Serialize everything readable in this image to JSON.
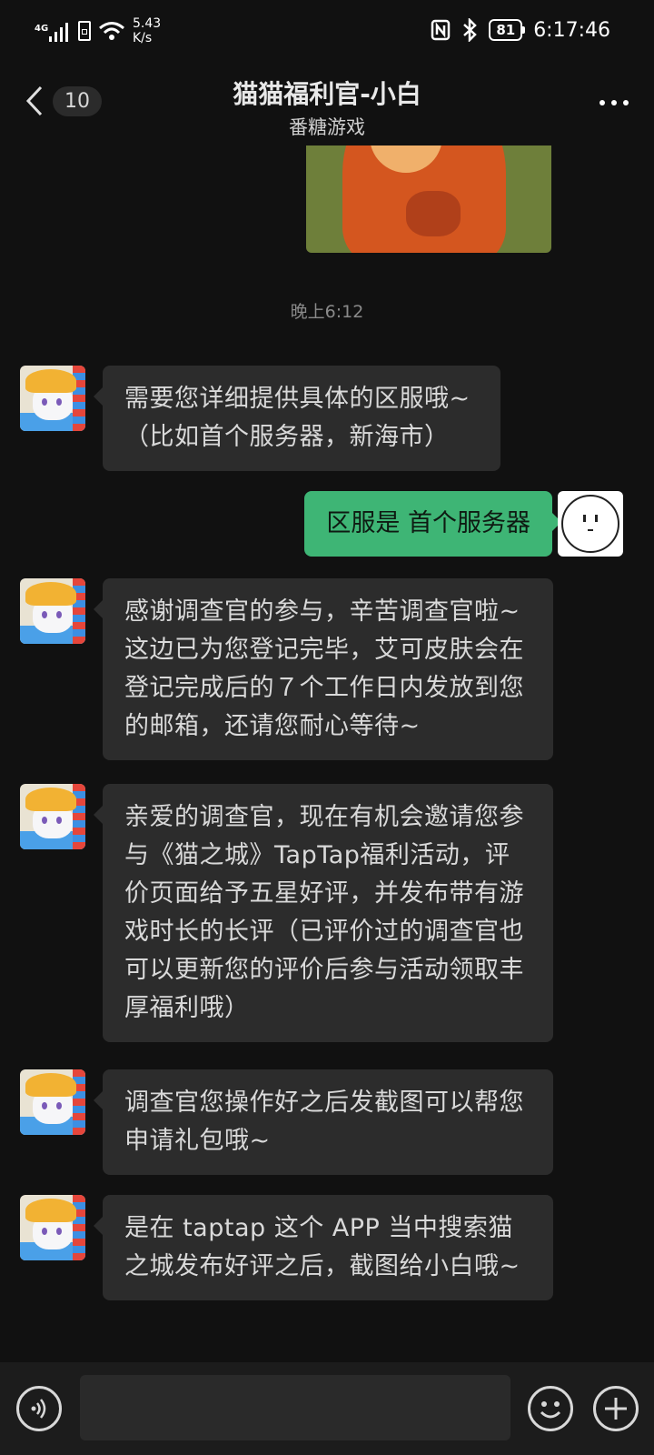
{
  "status_bar": {
    "network": "4G",
    "speed": "5.43\nK/s",
    "battery": "81",
    "time": "6:17:46"
  },
  "header": {
    "unread_count": "10",
    "title": "猫猫福利官-小白",
    "subtitle": "番糖游戏"
  },
  "chat": {
    "timestamp": "晚上6:12",
    "messages": [
      {
        "from": "other",
        "text": "需要您详细提供具体的区服哦~（比如首个服务器，新海市）"
      },
      {
        "from": "me",
        "text": "区服是 首个服务器"
      },
      {
        "from": "other",
        "text": "感谢调查官的参与，辛苦调查官啦~这边已为您登记完毕，艾可皮肤会在登记完成后的７个工作日内发放到您的邮箱，还请您耐心等待~"
      },
      {
        "from": "other",
        "text": "亲爱的调查官，现在有机会邀请您参与《猫之城》TapTap福利活动，评价页面给予五星好评，并发布带有游戏时长的长评（已评价过的调查官也可以更新您的评价后参与活动领取丰厚福利哦）"
      },
      {
        "from": "other",
        "text": "调查官您操作好之后发截图可以帮您申请礼包哦~"
      },
      {
        "from": "other",
        "text": "是在 taptap 这个 APP 当中搜索猫之城发布好评之后，截图给小白哦~"
      }
    ]
  },
  "icons": {
    "back": "chevron-left-icon",
    "more": "more-dots-icon",
    "voice": "voice-icon",
    "emoji": "emoji-icon",
    "plus": "plus-icon"
  },
  "colors": {
    "background": "#111111",
    "bubble_other": "#2c2c2c",
    "bubble_me": "#3eb575"
  }
}
